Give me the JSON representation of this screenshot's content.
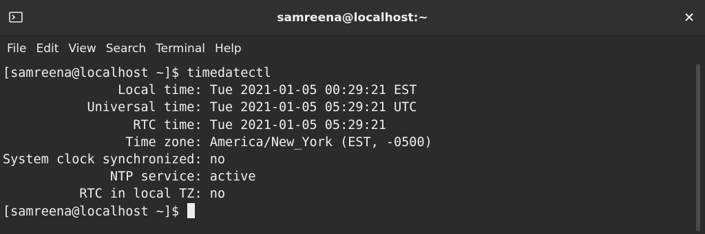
{
  "window": {
    "title": "samreena@localhost:~"
  },
  "icons": {
    "terminal": "terminal-icon",
    "close": "close-icon"
  },
  "menu": [
    "File",
    "Edit",
    "View",
    "Search",
    "Terminal",
    "Help"
  ],
  "terminal": {
    "lines": [
      "[samreena@localhost ~]$ timedatectl",
      "               Local time: Tue 2021-01-05 00:29:21 EST",
      "           Universal time: Tue 2021-01-05 05:29:21 UTC",
      "                 RTC time: Tue 2021-01-05 05:29:21",
      "                Time zone: America/New_York (EST, -0500)",
      "System clock synchronized: no",
      "              NTP service: active",
      "          RTC in local TZ: no"
    ],
    "prompt": "[samreena@localhost ~]$ "
  },
  "colors": {
    "background": "#2b2b2b",
    "foreground": "#eeeeec",
    "titlebar": "#2f3030"
  }
}
